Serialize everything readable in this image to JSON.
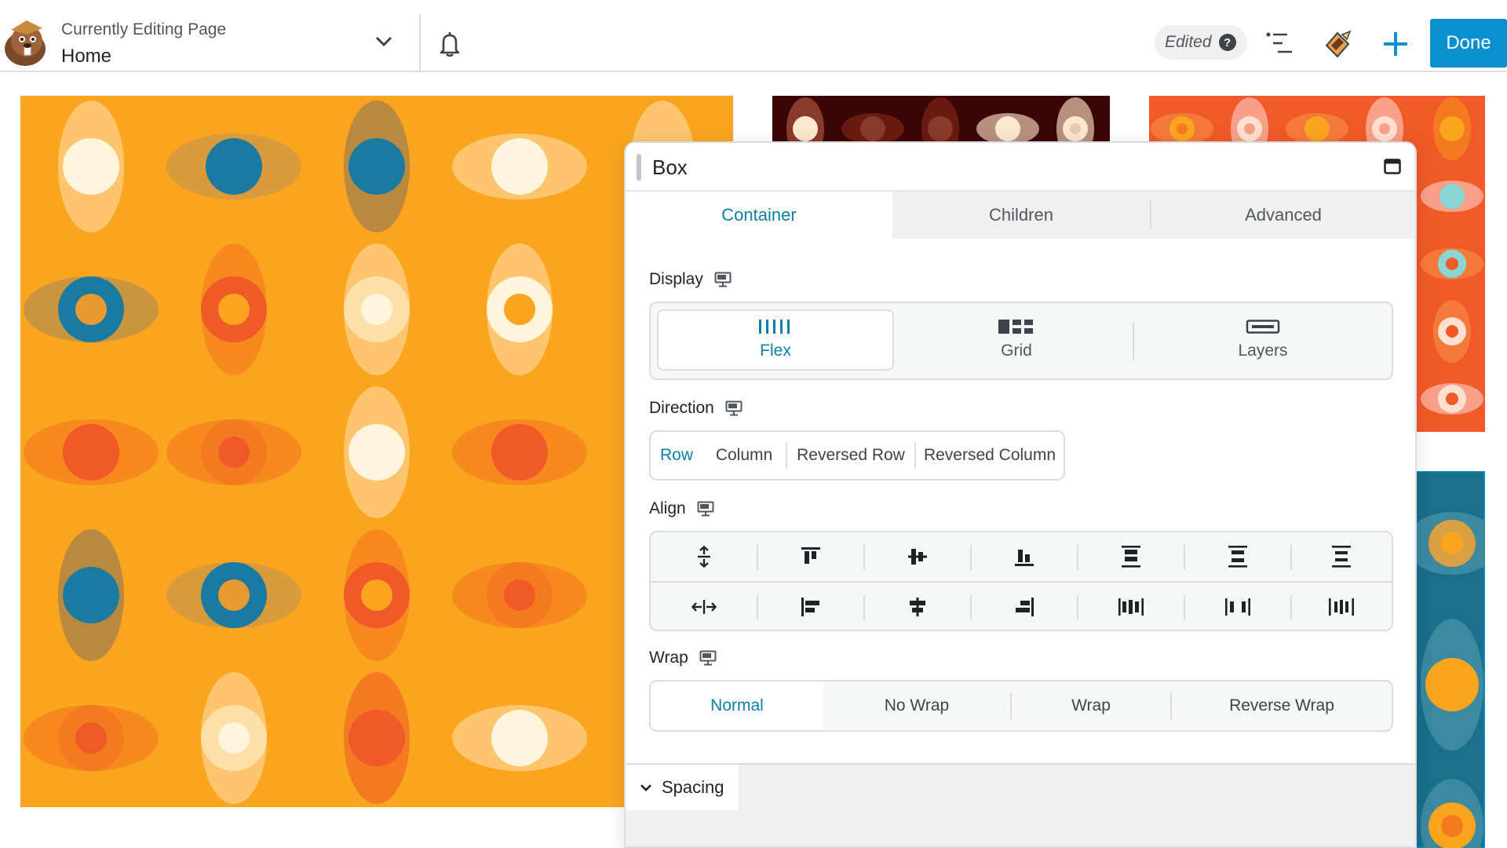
{
  "header": {
    "editing_label": "Currently Editing Page",
    "page_title": "Home",
    "status_label": "Edited",
    "help_glyph": "?",
    "done_label": "Done"
  },
  "panel": {
    "title": "Box",
    "tabs": [
      {
        "label": "Container",
        "active": true
      },
      {
        "label": "Children",
        "active": false
      },
      {
        "label": "Advanced",
        "active": false
      }
    ],
    "display": {
      "label": "Display",
      "options": [
        {
          "label": "Flex",
          "icon": "flex-icon",
          "active": true
        },
        {
          "label": "Grid",
          "icon": "grid-icon",
          "active": false
        },
        {
          "label": "Layers",
          "icon": "layers-icon",
          "active": false
        }
      ]
    },
    "direction": {
      "label": "Direction",
      "options": [
        {
          "label": "Row",
          "active": true
        },
        {
          "label": "Column",
          "active": false
        },
        {
          "label": "Reversed Row",
          "active": false
        },
        {
          "label": "Reversed Column",
          "active": false
        }
      ]
    },
    "align": {
      "label": "Align",
      "rows": [
        [
          "stretch-vertical-icon",
          "align-top-icon",
          "align-middle-icon",
          "align-bottom-icon",
          "space-between-vertical-icon",
          "space-around-vertical-icon",
          "space-evenly-vertical-icon"
        ],
        [
          "stretch-horizontal-icon",
          "align-left-icon",
          "align-center-icon",
          "align-right-icon",
          "space-between-horizontal-icon",
          "space-around-horizontal-icon",
          "space-evenly-horizontal-icon"
        ]
      ]
    },
    "wrap": {
      "label": "Wrap",
      "options": [
        {
          "label": "Normal",
          "active": true
        },
        {
          "label": "No Wrap",
          "active": false
        },
        {
          "label": "Wrap",
          "active": false
        },
        {
          "label": "Reverse Wrap",
          "active": false
        }
      ]
    },
    "spacing_section": "Spacing"
  },
  "colors": {
    "accent": "#0b7fa8",
    "done_button": "#0a90d0",
    "tile_orange": "#fba51e",
    "tile_maroon": "#3b0505",
    "tile_red_orange": "#f05a28",
    "tile_teal": "#1a6f8c"
  }
}
